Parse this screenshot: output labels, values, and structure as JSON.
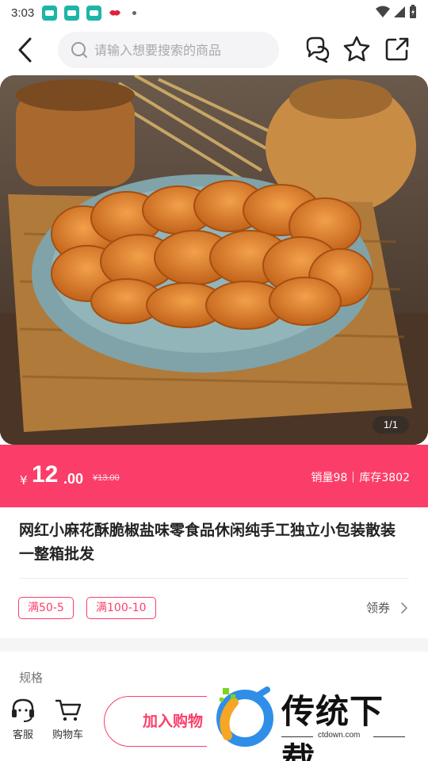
{
  "status_bar": {
    "time": "3:03"
  },
  "header": {
    "search_placeholder": "请输入想要搜索的商品"
  },
  "gallery": {
    "counter": "1/1"
  },
  "price": {
    "currency": "¥",
    "integer": "12",
    "decimal": ".00",
    "original": "¥13.00",
    "sales": "销量98",
    "stock": "库存3802"
  },
  "product": {
    "title": "网红小麻花酥脆椒盐味零食品休闲纯手工独立小包装散装一整箱批发"
  },
  "coupons": {
    "tags": [
      "满50-5",
      "满100-10"
    ],
    "link_label": "领券"
  },
  "spec": {
    "label": "规格"
  },
  "bottom_bar": {
    "service_label": "客服",
    "cart_label": "购物车",
    "add_cart_label": "加入购物"
  },
  "watermark": {
    "title": "传统下载",
    "url": "ctdown.com"
  },
  "colors": {
    "accent": "#fb3e69",
    "notif_icon": "#1cb6a8"
  }
}
